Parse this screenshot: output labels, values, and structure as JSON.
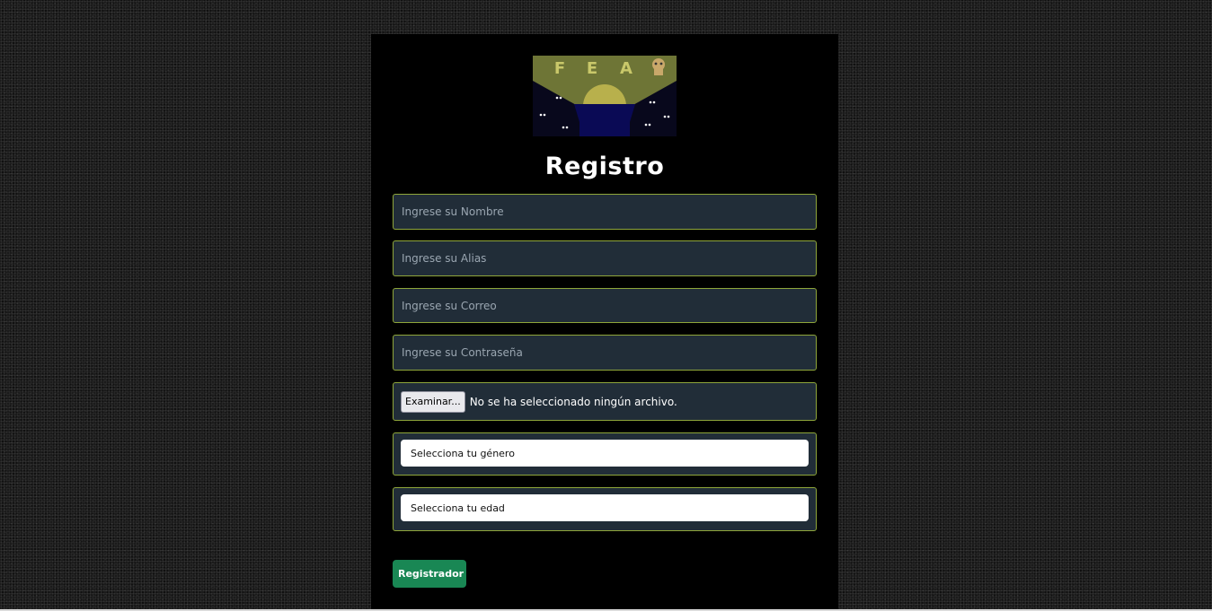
{
  "logo": {
    "letters": [
      "F",
      "E",
      "A"
    ],
    "icon": "ghost-creature-icon"
  },
  "form": {
    "title": "Registro",
    "name_placeholder": "Ingrese su Nombre",
    "alias_placeholder": "Ingrese su Alias",
    "email_placeholder": "Ingrese su Correo",
    "password_placeholder": "Ingrese su Contraseña",
    "file_button_label": "Examinar...",
    "file_status": "No se ha seleccionado ningún archivo.",
    "gender_select": "Selecciona tu género",
    "age_select": "Selecciona tu edad",
    "submit_label": "Registrador"
  },
  "colors": {
    "field_bg": "#212d38",
    "field_border": "#8fa63a",
    "submit_bg": "#198754",
    "panel_bg": "#000000"
  }
}
